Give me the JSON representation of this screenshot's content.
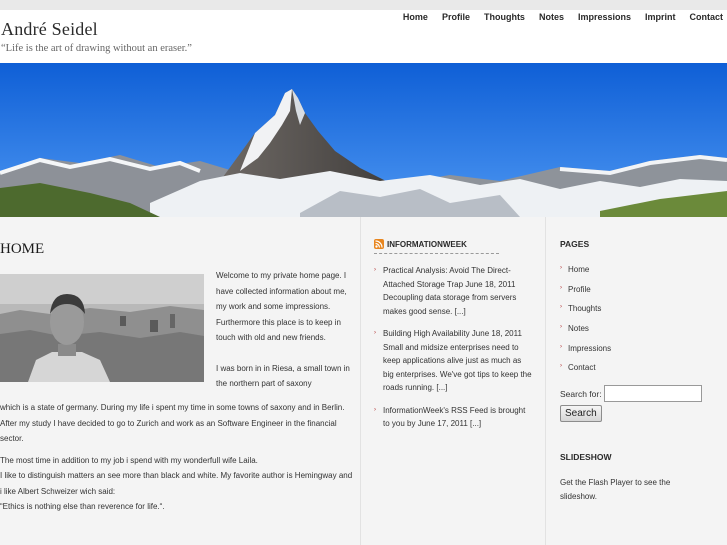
{
  "site": {
    "title": "André Seidel",
    "tagline": "“Life is the art of drawing without an eraser.”"
  },
  "nav": {
    "items": [
      "Home",
      "Profile",
      "Thoughts",
      "Notes",
      "Impressions",
      "Imprint",
      "Contact"
    ]
  },
  "main": {
    "heading": "HOME",
    "intro": "Welcome to my private home page. I have collected information about me, my work and some impressions. Furthermore this place is to keep in touch with old and new friends.",
    "born_start": "I was born in in Riesa, a small town in the northern part of saxony",
    "born_rest": "which is a state of germany. During my life i spent my time in some towns of saxony and in Berlin. After my study I have decided to go to Zurich and work as an Software Engineer in the financial sector.",
    "wife": "The most time in addition to my job i spend with my wonderfull wife Laila.",
    "likes": "I like to distinguish matters an see more than black and white. My favorite author is Hemingway and i like Albert Schweizer wich said:",
    "quote": "“Ethics is nothing else than reverence for life.“."
  },
  "feed": {
    "title": "INFORMATIONWEEK",
    "items": [
      "Practical Analysis: Avoid The Direct-Attached Storage Trap June 18, 2011 Decoupling data storage from servers makes good sense. [...]",
      "Building High Availability June 18, 2011 Small and midsize enterprises need to keep applications alive just as much as big enterprises. We've got tips to keep the roads running. [...]",
      "InformationWeek's RSS Feed is brought to you by June 17, 2011 [...]"
    ]
  },
  "sidebar": {
    "pages_heading": "PAGES",
    "pages": [
      "Home",
      "Profile",
      "Thoughts",
      "Notes",
      "Impressions",
      "Contact"
    ],
    "search_label": "Search for:",
    "search_button": "Search",
    "search_value": "",
    "slideshow_heading": "SLIDESHOW",
    "slideshow_text": "Get the Flash Player to see the slideshow."
  },
  "colors": {
    "sky": "#1f6ee6",
    "content_bg": "#f4f4f4",
    "bullet": "#b03030"
  }
}
